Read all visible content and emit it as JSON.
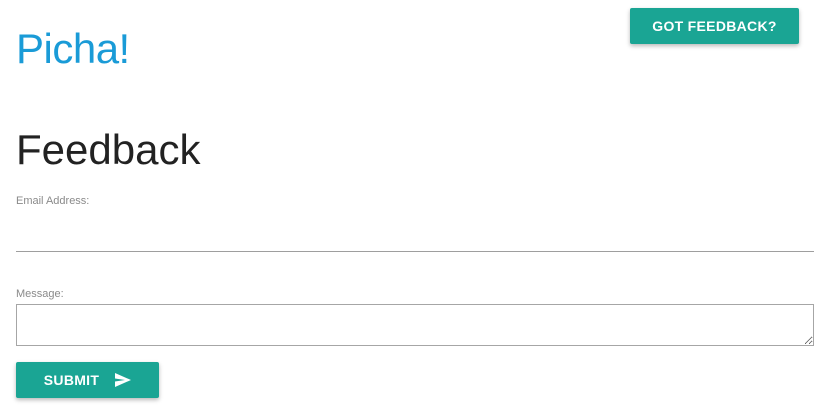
{
  "header": {
    "brand": "Picha!",
    "feedback_button_label": "GOT FEEDBACK?"
  },
  "main": {
    "title": "Feedback",
    "email": {
      "label": "Email Address:",
      "value": "",
      "placeholder": ""
    },
    "message": {
      "label": "Message:",
      "value": "",
      "placeholder": ""
    },
    "submit_label": "SUBMIT",
    "submit_icon": "send-icon"
  },
  "colors": {
    "brand": "#1a9bd7",
    "accent": "#1aa594",
    "title_text": "#222222",
    "label_text": "#8a8a8a"
  }
}
